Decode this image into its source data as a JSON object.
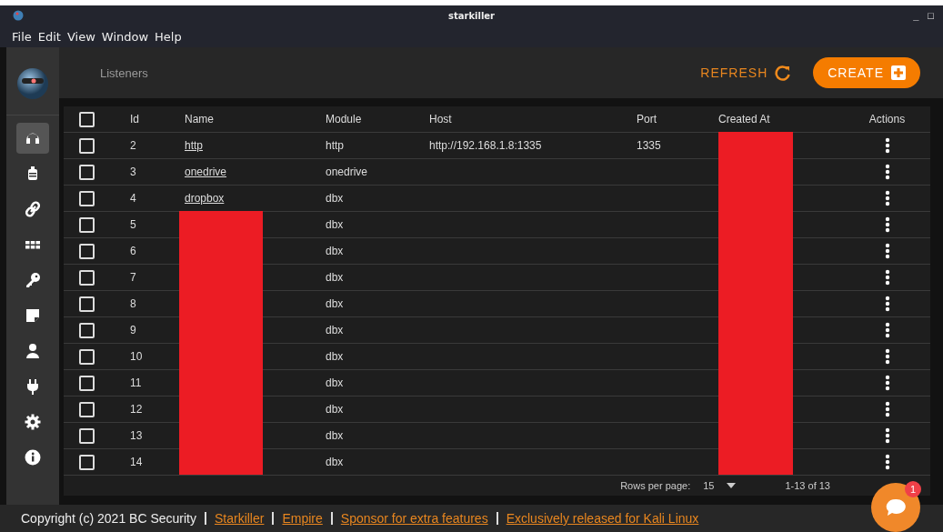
{
  "window": {
    "title": "starkiller",
    "controls": [
      "_",
      "□"
    ]
  },
  "menu": [
    "File",
    "Edit",
    "View",
    "Window",
    "Help"
  ],
  "sidebar": {
    "items": [
      {
        "kind": "headphones",
        "selected": true
      },
      {
        "kind": "suitcase",
        "selected": false
      },
      {
        "kind": "link",
        "selected": false
      },
      {
        "kind": "grid",
        "selected": false
      },
      {
        "kind": "key",
        "selected": false
      },
      {
        "kind": "note",
        "selected": false
      },
      {
        "kind": "user",
        "selected": false
      },
      {
        "kind": "plug",
        "selected": false
      },
      {
        "kind": "gear",
        "selected": false
      },
      {
        "kind": "info",
        "selected": false
      }
    ]
  },
  "header": {
    "title": "Listeners",
    "refresh": "REFRESH",
    "create": "CREATE"
  },
  "table": {
    "columns": [
      "Id",
      "Name",
      "Module",
      "Host",
      "Port",
      "Created At",
      "Actions"
    ],
    "select_all": {
      "checked": false
    },
    "rows": [
      {
        "checked": false,
        "id": "2",
        "name": "http",
        "module": "http",
        "host": "http://192.168.1.8:1335",
        "port": "1335",
        "name_redacted": false,
        "created_redacted": true
      },
      {
        "checked": false,
        "id": "3",
        "name": "onedrive",
        "module": "onedrive",
        "name_redacted": false,
        "created_redacted": true
      },
      {
        "checked": false,
        "id": "4",
        "name": "dropbox",
        "module": "dbx",
        "name_redacted": false,
        "created_redacted": true
      },
      {
        "checked": false,
        "id": "5",
        "module": "dbx",
        "name_redacted": true,
        "created_redacted": true
      },
      {
        "checked": false,
        "id": "6",
        "module": "dbx",
        "name_redacted": true,
        "created_redacted": true
      },
      {
        "checked": false,
        "id": "7",
        "module": "dbx",
        "name_redacted": true,
        "created_redacted": true
      },
      {
        "checked": false,
        "id": "8",
        "module": "dbx",
        "name_redacted": true,
        "created_redacted": true
      },
      {
        "checked": false,
        "id": "9",
        "module": "dbx",
        "name_redacted": true,
        "created_redacted": true
      },
      {
        "checked": false,
        "id": "10",
        "module": "dbx",
        "name_redacted": true,
        "created_redacted": true
      },
      {
        "checked": false,
        "id": "11",
        "module": "dbx",
        "name_redacted": true,
        "created_redacted": true
      },
      {
        "checked": false,
        "id": "12",
        "module": "dbx",
        "name_redacted": true,
        "created_redacted": true
      },
      {
        "checked": false,
        "id": "13",
        "module": "dbx",
        "name_redacted": true,
        "created_redacted": true
      },
      {
        "checked": false,
        "id": "14",
        "module": "dbx",
        "name_redacted": true,
        "created_redacted": true
      }
    ],
    "pagination": {
      "rows_per_page_label": "Rows per page:",
      "rows_per_page": "15",
      "range": "1-13 of 13"
    }
  },
  "footer": {
    "copyright": "Copyright (c) 2021 BC Security",
    "links": [
      "Starkiller",
      "Empire",
      "Sponsor for extra features",
      "Exclusively released for Kali Linux"
    ]
  },
  "chat": {
    "badge": "1"
  }
}
